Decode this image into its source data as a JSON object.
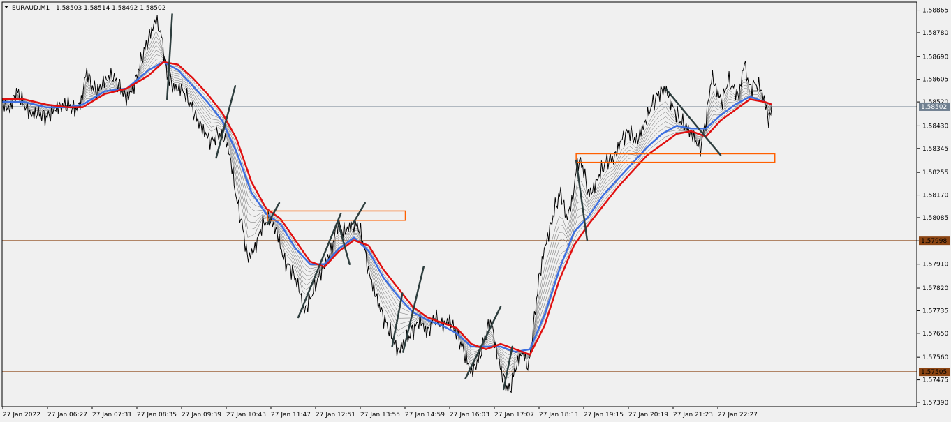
{
  "window": {
    "title": "EURAUD,M1",
    "ohlc": "1.58503 1.58514 1.58492 1.58502"
  },
  "colors": {
    "background": "#f0f0f0",
    "price_bars": "#000000",
    "ma_fast": "#3d6fe0",
    "ma_slow": "#e01010",
    "ribbon": "#333333",
    "support_lines": "#8b4513",
    "zones": "#ff6000",
    "trend_lines": "#2e3e3e",
    "bid_line": "#708090"
  },
  "chart_data": {
    "type": "line",
    "symbol": "EURAUD",
    "timeframe": "M1",
    "ylim": [
      1.5739,
      1.5889
    ],
    "y_ticks": [
      "1.58865",
      "1.58780",
      "1.58690",
      "1.58605",
      "1.58520",
      "1.58430",
      "1.58345",
      "1.58255",
      "1.58170",
      "1.58085",
      "1.57998",
      "1.57910",
      "1.57820",
      "1.57735",
      "1.57650",
      "1.57560",
      "1.57475",
      "1.57390"
    ],
    "x_ticks": [
      "27 Jan 2022",
      "27 Jan 06:27",
      "27 Jan 07:31",
      "27 Jan 08:35",
      "27 Jan 09:39",
      "27 Jan 10:43",
      "27 Jan 11:47",
      "27 Jan 12:51",
      "27 Jan 13:55",
      "27 Jan 14:59",
      "27 Jan 16:03",
      "27 Jan 17:07",
      "27 Jan 18:11",
      "27 Jan 19:15",
      "27 Jan 20:19",
      "27 Jan 21:23",
      "27 Jan 22:27"
    ],
    "x_index_range": [
      0,
      1000
    ],
    "price_path": [
      [
        0,
        1.5852
      ],
      [
        10,
        1.5849
      ],
      [
        20,
        1.5856
      ],
      [
        30,
        1.5851
      ],
      [
        40,
        1.5847
      ],
      [
        50,
        1.5848
      ],
      [
        60,
        1.5846
      ],
      [
        75,
        1.585
      ],
      [
        90,
        1.5851
      ],
      [
        100,
        1.5849
      ],
      [
        108,
        1.5852
      ],
      [
        115,
        1.5864
      ],
      [
        122,
        1.5858
      ],
      [
        130,
        1.5856
      ],
      [
        140,
        1.586
      ],
      [
        150,
        1.5862
      ],
      [
        160,
        1.5858
      ],
      [
        170,
        1.5853
      ],
      [
        180,
        1.5858
      ],
      [
        190,
        1.5868
      ],
      [
        200,
        1.5876
      ],
      [
        210,
        1.5883
      ],
      [
        218,
        1.5876
      ],
      [
        225,
        1.5862
      ],
      [
        235,
        1.5857
      ],
      [
        245,
        1.5857
      ],
      [
        255,
        1.5852
      ],
      [
        265,
        1.5846
      ],
      [
        275,
        1.5841
      ],
      [
        285,
        1.5837
      ],
      [
        295,
        1.584
      ],
      [
        305,
        1.5838
      ],
      [
        312,
        1.583
      ],
      [
        320,
        1.5815
      ],
      [
        328,
        1.5805
      ],
      [
        335,
        1.5793
      ],
      [
        345,
        1.5797
      ],
      [
        355,
        1.5806
      ],
      [
        365,
        1.5808
      ],
      [
        375,
        1.5803
      ],
      [
        385,
        1.5792
      ],
      [
        395,
        1.5789
      ],
      [
        405,
        1.5782
      ],
      [
        412,
        1.5773
      ],
      [
        420,
        1.5778
      ],
      [
        430,
        1.5785
      ],
      [
        440,
        1.5791
      ],
      [
        450,
        1.5797
      ],
      [
        458,
        1.5807
      ],
      [
        465,
        1.5803
      ],
      [
        475,
        1.5805
      ],
      [
        485,
        1.5806
      ],
      [
        492,
        1.58
      ],
      [
        500,
        1.5788
      ],
      [
        510,
        1.5779
      ],
      [
        520,
        1.5771
      ],
      [
        530,
        1.5765
      ],
      [
        540,
        1.5758
      ],
      [
        550,
        1.5762
      ],
      [
        560,
        1.5766
      ],
      [
        570,
        1.577
      ],
      [
        580,
        1.5765
      ],
      [
        590,
        1.5771
      ],
      [
        600,
        1.5768
      ],
      [
        610,
        1.577
      ],
      [
        620,
        1.5765
      ],
      [
        630,
        1.5758
      ],
      [
        640,
        1.575
      ],
      [
        650,
        1.5755
      ],
      [
        660,
        1.5765
      ],
      [
        667,
        1.577
      ],
      [
        675,
        1.5757
      ],
      [
        685,
        1.5747
      ],
      [
        692,
        1.5743
      ],
      [
        700,
        1.5752
      ],
      [
        710,
        1.5758
      ],
      [
        718,
        1.5752
      ],
      [
        725,
        1.5768
      ],
      [
        732,
        1.5785
      ],
      [
        740,
        1.5797
      ],
      [
        748,
        1.5805
      ],
      [
        755,
        1.5813
      ],
      [
        762,
        1.5818
      ],
      [
        770,
        1.5808
      ],
      [
        778,
        1.5815
      ],
      [
        785,
        1.583
      ],
      [
        792,
        1.5828
      ],
      [
        800,
        1.5817
      ],
      [
        808,
        1.582
      ],
      [
        815,
        1.5825
      ],
      [
        825,
        1.583
      ],
      [
        835,
        1.5831
      ],
      [
        845,
        1.5838
      ],
      [
        855,
        1.5841
      ],
      [
        865,
        1.5837
      ],
      [
        875,
        1.5843
      ],
      [
        885,
        1.585
      ],
      [
        895,
        1.5855
      ],
      [
        905,
        1.5857
      ],
      [
        915,
        1.585
      ],
      [
        925,
        1.5845
      ],
      [
        935,
        1.5842
      ],
      [
        945,
        1.5838
      ],
      [
        952,
        1.5834
      ],
      [
        960,
        1.5845
      ],
      [
        968,
        1.5862
      ],
      [
        975,
        1.5856
      ],
      [
        982,
        1.5852
      ],
      [
        990,
        1.586
      ],
      [
        998,
        1.5857
      ],
      [
        1005,
        1.5854
      ],
      [
        1012,
        1.5867
      ],
      [
        1020,
        1.5857
      ],
      [
        1028,
        1.5859
      ],
      [
        1035,
        1.5857
      ],
      [
        1042,
        1.585
      ],
      [
        1046,
        1.5844
      ],
      [
        1050,
        1.585
      ]
    ],
    "ma_slow_path": [
      [
        0,
        1.5853
      ],
      [
        30,
        1.5853
      ],
      [
        60,
        1.5851
      ],
      [
        90,
        1.585
      ],
      [
        110,
        1.585
      ],
      [
        140,
        1.5855
      ],
      [
        170,
        1.5857
      ],
      [
        200,
        1.5862
      ],
      [
        220,
        1.5867
      ],
      [
        240,
        1.5866
      ],
      [
        260,
        1.5861
      ],
      [
        280,
        1.5855
      ],
      [
        300,
        1.5848
      ],
      [
        320,
        1.5838
      ],
      [
        340,
        1.5822
      ],
      [
        360,
        1.5812
      ],
      [
        380,
        1.5808
      ],
      [
        400,
        1.58
      ],
      [
        420,
        1.5792
      ],
      [
        440,
        1.579
      ],
      [
        460,
        1.5796
      ],
      [
        480,
        1.58
      ],
      [
        500,
        1.5798
      ],
      [
        520,
        1.5789
      ],
      [
        540,
        1.5782
      ],
      [
        560,
        1.5775
      ],
      [
        580,
        1.5771
      ],
      [
        600,
        1.5769
      ],
      [
        620,
        1.5767
      ],
      [
        640,
        1.5761
      ],
      [
        660,
        1.5759
      ],
      [
        680,
        1.5761
      ],
      [
        700,
        1.5759
      ],
      [
        720,
        1.5757
      ],
      [
        740,
        1.5768
      ],
      [
        760,
        1.5785
      ],
      [
        780,
        1.5798
      ],
      [
        800,
        1.5806
      ],
      [
        820,
        1.5813
      ],
      [
        840,
        1.582
      ],
      [
        860,
        1.5826
      ],
      [
        880,
        1.5832
      ],
      [
        900,
        1.5836
      ],
      [
        920,
        1.584
      ],
      [
        940,
        1.5841
      ],
      [
        960,
        1.5839
      ],
      [
        980,
        1.5845
      ],
      [
        1000,
        1.5849
      ],
      [
        1020,
        1.5853
      ],
      [
        1040,
        1.5852
      ],
      [
        1050,
        1.5851
      ]
    ],
    "ma_fast_path": [
      [
        0,
        1.5852
      ],
      [
        30,
        1.5852
      ],
      [
        60,
        1.585
      ],
      [
        90,
        1.585
      ],
      [
        110,
        1.5851
      ],
      [
        140,
        1.5856
      ],
      [
        170,
        1.5857
      ],
      [
        200,
        1.5864
      ],
      [
        220,
        1.5867
      ],
      [
        240,
        1.5864
      ],
      [
        260,
        1.5858
      ],
      [
        280,
        1.5852
      ],
      [
        300,
        1.5845
      ],
      [
        320,
        1.5833
      ],
      [
        340,
        1.5818
      ],
      [
        360,
        1.581
      ],
      [
        380,
        1.5806
      ],
      [
        400,
        1.5797
      ],
      [
        420,
        1.5791
      ],
      [
        440,
        1.5791
      ],
      [
        460,
        1.5797
      ],
      [
        480,
        1.5801
      ],
      [
        500,
        1.5796
      ],
      [
        520,
        1.5786
      ],
      [
        540,
        1.5779
      ],
      [
        560,
        1.5773
      ],
      [
        580,
        1.577
      ],
      [
        600,
        1.5768
      ],
      [
        620,
        1.5765
      ],
      [
        640,
        1.576
      ],
      [
        660,
        1.576
      ],
      [
        680,
        1.576
      ],
      [
        700,
        1.5758
      ],
      [
        720,
        1.5759
      ],
      [
        740,
        1.5772
      ],
      [
        760,
        1.5789
      ],
      [
        780,
        1.5803
      ],
      [
        800,
        1.5809
      ],
      [
        820,
        1.5817
      ],
      [
        840,
        1.5823
      ],
      [
        860,
        1.5829
      ],
      [
        880,
        1.5835
      ],
      [
        900,
        1.584
      ],
      [
        920,
        1.5843
      ],
      [
        940,
        1.5842
      ],
      [
        960,
        1.5842
      ],
      [
        980,
        1.5847
      ],
      [
        1000,
        1.5851
      ],
      [
        1020,
        1.5854
      ],
      [
        1040,
        1.5852
      ],
      [
        1050,
        1.5851
      ]
    ],
    "horizontal_levels": [
      {
        "value": 1.57998,
        "label": "1.57998",
        "kind": "support"
      },
      {
        "value": 1.57505,
        "label": "1.57505",
        "kind": "support"
      },
      {
        "value": 1.58502,
        "label": "1.58502",
        "kind": "bid"
      }
    ],
    "zones": [
      {
        "x0": 362,
        "x1": 550,
        "y0": 1.5811,
        "y1": 1.58075
      },
      {
        "x0": 783,
        "x1": 1054,
        "y0": 1.58325,
        "y1": 1.58293
      }
    ],
    "trend_lines": [
      [
        225,
        1.5853,
        232,
        1.5885
      ],
      [
        292,
        1.5831,
        318,
        1.5858
      ],
      [
        362,
        1.5806,
        378,
        1.5814
      ],
      [
        404,
        1.5771,
        462,
        1.581
      ],
      [
        458,
        1.5807,
        474,
        1.5791
      ],
      [
        478,
        1.5806,
        495,
        1.5814
      ],
      [
        532,
        1.576,
        546,
        1.578
      ],
      [
        547,
        1.5758,
        575,
        1.579
      ],
      [
        632,
        1.5748,
        680,
        1.5775
      ],
      [
        684,
        1.5744,
        696,
        1.576
      ],
      [
        783,
        1.583,
        798,
        1.58
      ],
      [
        905,
        1.5857,
        980,
        1.5832
      ]
    ]
  }
}
